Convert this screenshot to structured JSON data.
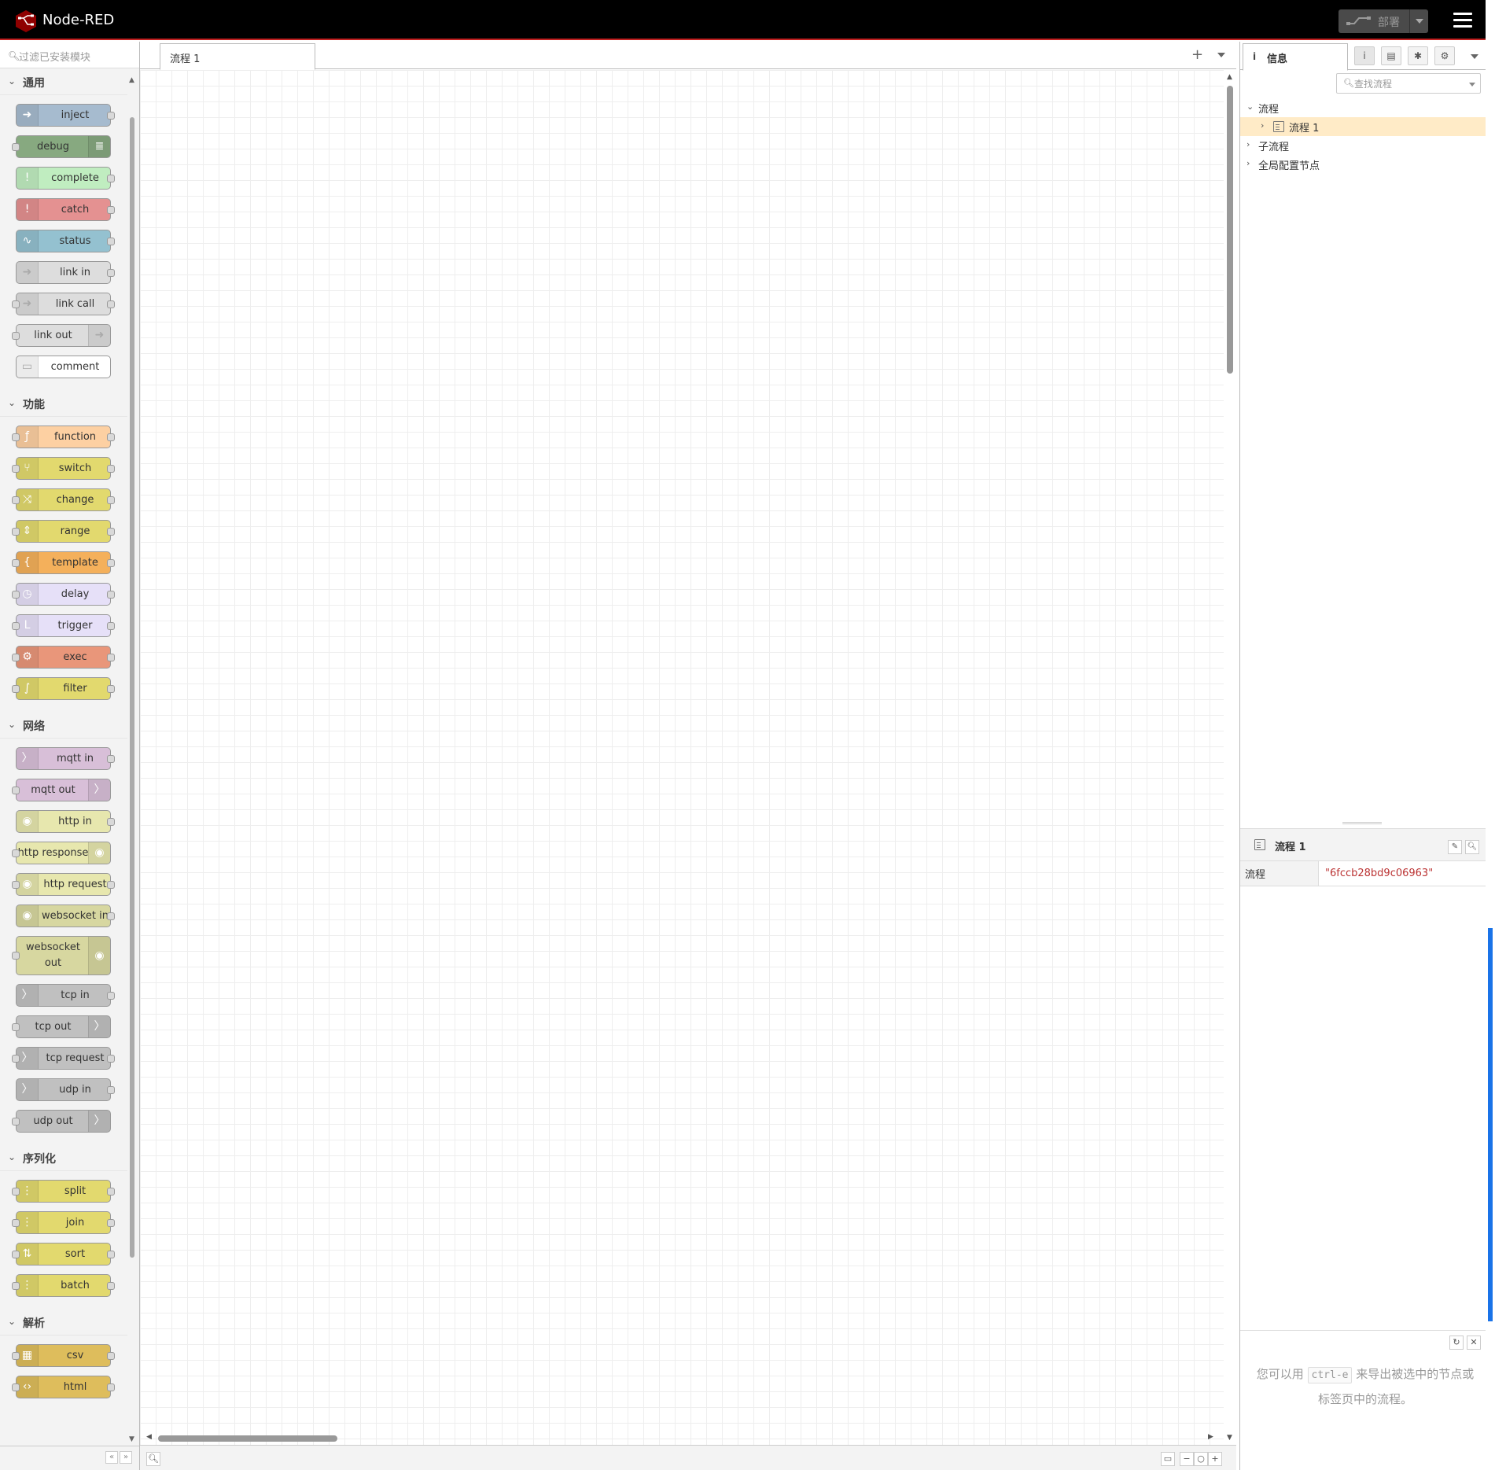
{
  "app": {
    "title": "Node-RED"
  },
  "header": {
    "deploy_label": "部署"
  },
  "palette": {
    "search_placeholder": "过滤已安装模块",
    "categories": [
      {
        "label": "通用",
        "nodes": [
          {
            "label": "inject",
            "color": "#a6bbcf",
            "icon": "arrow-right-icon",
            "side": "left",
            "in": false,
            "out": true
          },
          {
            "label": "debug",
            "color": "#87a980",
            "icon": "list-icon",
            "side": "right",
            "in": true,
            "out": false
          },
          {
            "label": "complete",
            "color": "#c0edc0",
            "icon": "exclamation-icon",
            "side": "left",
            "in": false,
            "out": true
          },
          {
            "label": "catch",
            "color": "#e49191",
            "icon": "exclamation-icon",
            "side": "left",
            "in": false,
            "out": true
          },
          {
            "label": "status",
            "color": "#94c1d0",
            "icon": "pulse-icon",
            "side": "left",
            "in": false,
            "out": true
          },
          {
            "label": "link in",
            "color": "#dddddd",
            "icon": "link-icon",
            "side": "left",
            "in": false,
            "out": true
          },
          {
            "label": "link call",
            "color": "#dddddd",
            "icon": "link-icon",
            "side": "left",
            "in": true,
            "out": true
          },
          {
            "label": "link out",
            "color": "#dddddd",
            "icon": "link-icon",
            "side": "right",
            "in": true,
            "out": false
          },
          {
            "label": "comment",
            "color": "#ffffff",
            "icon": "comment-icon",
            "side": "left",
            "in": false,
            "out": false
          }
        ]
      },
      {
        "label": "功能",
        "nodes": [
          {
            "label": "function",
            "color": "#fdd0a2",
            "icon": "function-icon",
            "side": "left",
            "in": true,
            "out": true
          },
          {
            "label": "switch",
            "color": "#e2d96e",
            "icon": "switch-icon",
            "side": "left",
            "in": true,
            "out": true
          },
          {
            "label": "change",
            "color": "#e2d96e",
            "icon": "shuffle-icon",
            "side": "left",
            "in": true,
            "out": true
          },
          {
            "label": "range",
            "color": "#e2d96e",
            "icon": "range-icon",
            "side": "left",
            "in": true,
            "out": true
          },
          {
            "label": "template",
            "color": "#f4b05b",
            "icon": "brace-icon",
            "side": "left",
            "in": true,
            "out": true
          },
          {
            "label": "delay",
            "color": "#e6e0f8",
            "icon": "timer-icon",
            "side": "left",
            "in": true,
            "out": true
          },
          {
            "label": "trigger",
            "color": "#e6e0f8",
            "icon": "trigger-icon",
            "side": "left",
            "in": true,
            "out": true
          },
          {
            "label": "exec",
            "color": "#e9967a",
            "icon": "gear-icon",
            "side": "left",
            "in": true,
            "out": true
          },
          {
            "label": "filter",
            "color": "#e2d96e",
            "icon": "filter-icon",
            "side": "left",
            "in": true,
            "out": true
          }
        ]
      },
      {
        "label": "网络",
        "nodes": [
          {
            "label": "mqtt in",
            "color": "#d8bfd8",
            "icon": "signal-icon",
            "side": "left",
            "in": false,
            "out": true
          },
          {
            "label": "mqtt out",
            "color": "#d8bfd8",
            "icon": "signal-icon",
            "side": "right",
            "in": true,
            "out": false
          },
          {
            "label": "http in",
            "color": "#e7e7ae",
            "icon": "globe-icon",
            "side": "left",
            "in": false,
            "out": true
          },
          {
            "label": "http response",
            "color": "#e7e7ae",
            "icon": "globe-icon",
            "side": "right",
            "in": true,
            "out": false
          },
          {
            "label": "http request",
            "color": "#e7e7ae",
            "icon": "globe-icon",
            "side": "left",
            "in": true,
            "out": true
          },
          {
            "label": "websocket in",
            "color": "#d7d7a0",
            "icon": "globe-icon",
            "side": "left",
            "in": false,
            "out": true
          },
          {
            "label": "websocket out",
            "color": "#d7d7a0",
            "icon": "globe-icon",
            "side": "right",
            "in": true,
            "out": false,
            "tall": true
          },
          {
            "label": "tcp in",
            "color": "#c0c0c0",
            "icon": "signal-icon",
            "side": "left",
            "in": false,
            "out": true
          },
          {
            "label": "tcp out",
            "color": "#c0c0c0",
            "icon": "signal-icon",
            "side": "right",
            "in": true,
            "out": false
          },
          {
            "label": "tcp request",
            "color": "#c0c0c0",
            "icon": "signal-icon",
            "side": "left",
            "in": true,
            "out": true
          },
          {
            "label": "udp in",
            "color": "#c0c0c0",
            "icon": "signal-icon",
            "side": "left",
            "in": false,
            "out": true
          },
          {
            "label": "udp out",
            "color": "#c0c0c0",
            "icon": "signal-icon",
            "side": "right",
            "in": true,
            "out": false
          }
        ]
      },
      {
        "label": "序列化",
        "nodes": [
          {
            "label": "split",
            "color": "#e2d96e",
            "icon": "split-icon",
            "side": "left",
            "in": true,
            "out": true
          },
          {
            "label": "join",
            "color": "#e2d96e",
            "icon": "join-icon",
            "side": "left",
            "in": true,
            "out": true
          },
          {
            "label": "sort",
            "color": "#e2d96e",
            "icon": "sort-icon",
            "side": "left",
            "in": true,
            "out": true
          },
          {
            "label": "batch",
            "color": "#e2d96e",
            "icon": "batch-icon",
            "side": "left",
            "in": true,
            "out": true
          }
        ]
      },
      {
        "label": "解析",
        "nodes": [
          {
            "label": "csv",
            "color": "#debd5c",
            "icon": "csv-icon",
            "side": "left",
            "in": true,
            "out": true
          },
          {
            "label": "html",
            "color": "#debd5c",
            "icon": "html-icon",
            "side": "left",
            "in": true,
            "out": true
          }
        ]
      }
    ]
  },
  "workspace": {
    "tab_label": "流程 1"
  },
  "sidebar": {
    "tab_label": "信息",
    "search_placeholder": "查找流程",
    "tree": {
      "flows": "流程",
      "flow_item": "流程 1",
      "subflows": "子流程",
      "global_config": "全局配置节点"
    },
    "info": {
      "title": "流程 1",
      "prop_key": "流程",
      "prop_value": "\"6fccb28bd9c06963\""
    },
    "tip": {
      "before": "您可以用",
      "key": "ctrl-e",
      "after": "来导出被选中的节点或标签页中的流程。"
    }
  }
}
